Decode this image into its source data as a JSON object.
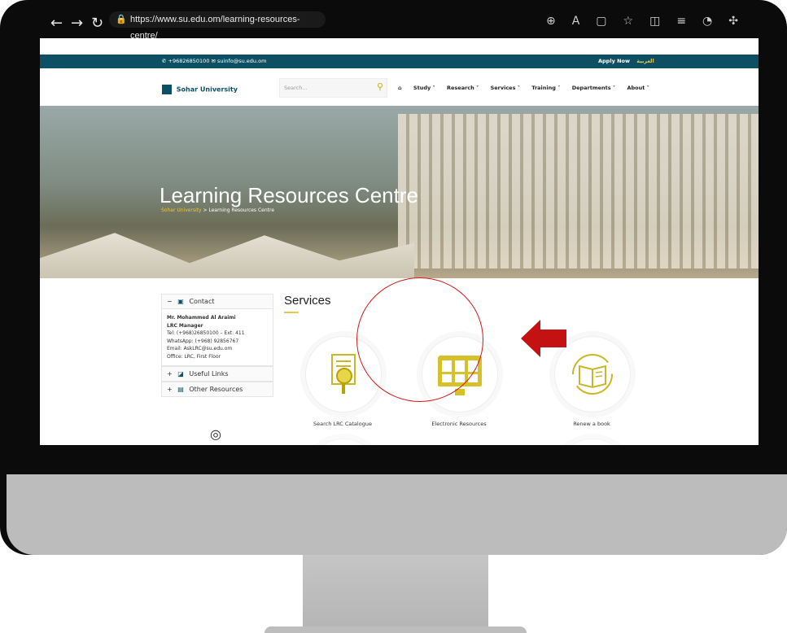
{
  "browser": {
    "url": "https://www.su.edu.om/learning-resources-centre/",
    "nav_icons": [
      "back-arrow-icon",
      "forward-arrow-icon",
      "reload-icon"
    ],
    "tool_icons": [
      "zoom-icon",
      "read-aloud-icon",
      "tab-icon",
      "favorite-star-icon",
      "split-icon",
      "favorites-list-icon",
      "collections-icon",
      "extensions-icon"
    ]
  },
  "topbar": {
    "contact": "✆ +96826850100  ✉ suinfo@su.edu.om",
    "apply": "Apply Now",
    "arabic": "العربية"
  },
  "header": {
    "logo_text": "Sohar University",
    "search_placeholder": "Search...",
    "menu": [
      "Study ˅",
      "Research ˅",
      "Services ˅",
      "Training ˅",
      "Departments ˅",
      "About ˅"
    ]
  },
  "hero": {
    "title": "Learning Resources Centre",
    "crumb_root": "Sohar University",
    "crumb_current": "> Learning Resources Centre"
  },
  "sidebar": {
    "contact_label": "Contact",
    "name": "Mr. Mohammed Al Araimi",
    "role": "LRC Manager",
    "tel": "Tel: (+968)26850100 – Ext: 411",
    "whatsapp": "WhatsApp: (+968) 92856767",
    "email": "Email: AskLRC@su.edu.om",
    "office": "Office: LRC, First Floor",
    "useful_links": "Useful Links",
    "other_resources": "Other Resources"
  },
  "services": {
    "title": "Services",
    "items": [
      "Search LRC Catalogue",
      "Electronic Resources",
      "Renew a book"
    ]
  },
  "colors": {
    "accent": "#e6c84b",
    "brand": "#0d4f63",
    "annotation": "#c41212"
  }
}
